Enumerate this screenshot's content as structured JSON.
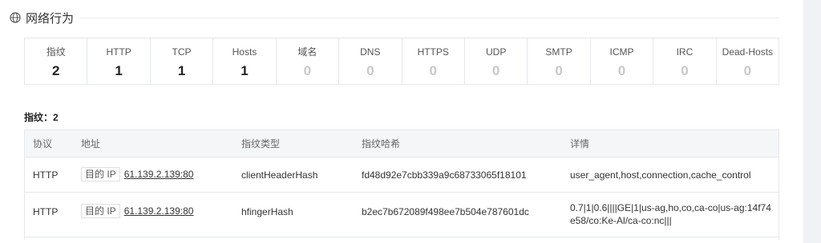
{
  "section": {
    "title": "网络行为",
    "icon": "globe-icon"
  },
  "stats": [
    {
      "label": "指纹",
      "value": "2"
    },
    {
      "label": "HTTP",
      "value": "1"
    },
    {
      "label": "TCP",
      "value": "1"
    },
    {
      "label": "Hosts",
      "value": "1"
    },
    {
      "label": "域名",
      "value": "0"
    },
    {
      "label": "DNS",
      "value": "0"
    },
    {
      "label": "HTTPS",
      "value": "0"
    },
    {
      "label": "UDP",
      "value": "0"
    },
    {
      "label": "SMTP",
      "value": "0"
    },
    {
      "label": "ICMP",
      "value": "0"
    },
    {
      "label": "IRC",
      "value": "0"
    },
    {
      "label": "Dead-Hosts",
      "value": "0"
    }
  ],
  "fingerprint": {
    "title": "指纹：2",
    "columns": [
      "协议",
      "地址",
      "指纹类型",
      "指纹哈希",
      "详情"
    ],
    "rows": [
      {
        "protocol": "HTTP",
        "tag": "目的 IP",
        "address": "61.139.2.139:80",
        "type": "clientHeaderHash",
        "hash": "fd48d92e7cbb339a9c68733065f18101",
        "detail": "user_agent,host,connection,cache_control"
      },
      {
        "protocol": "HTTP",
        "tag": "目的 IP",
        "address": "61.139.2.139:80",
        "type": "hfingerHash",
        "hash": "b2ec7b672089f498ee7b504e787601dc",
        "detail": "0.7|1|0.6||||GE|1|us-ag,ho,co,ca-co|us-ag:14f74e58/co:Ke-Al/ca-co:nc|||"
      }
    ]
  }
}
